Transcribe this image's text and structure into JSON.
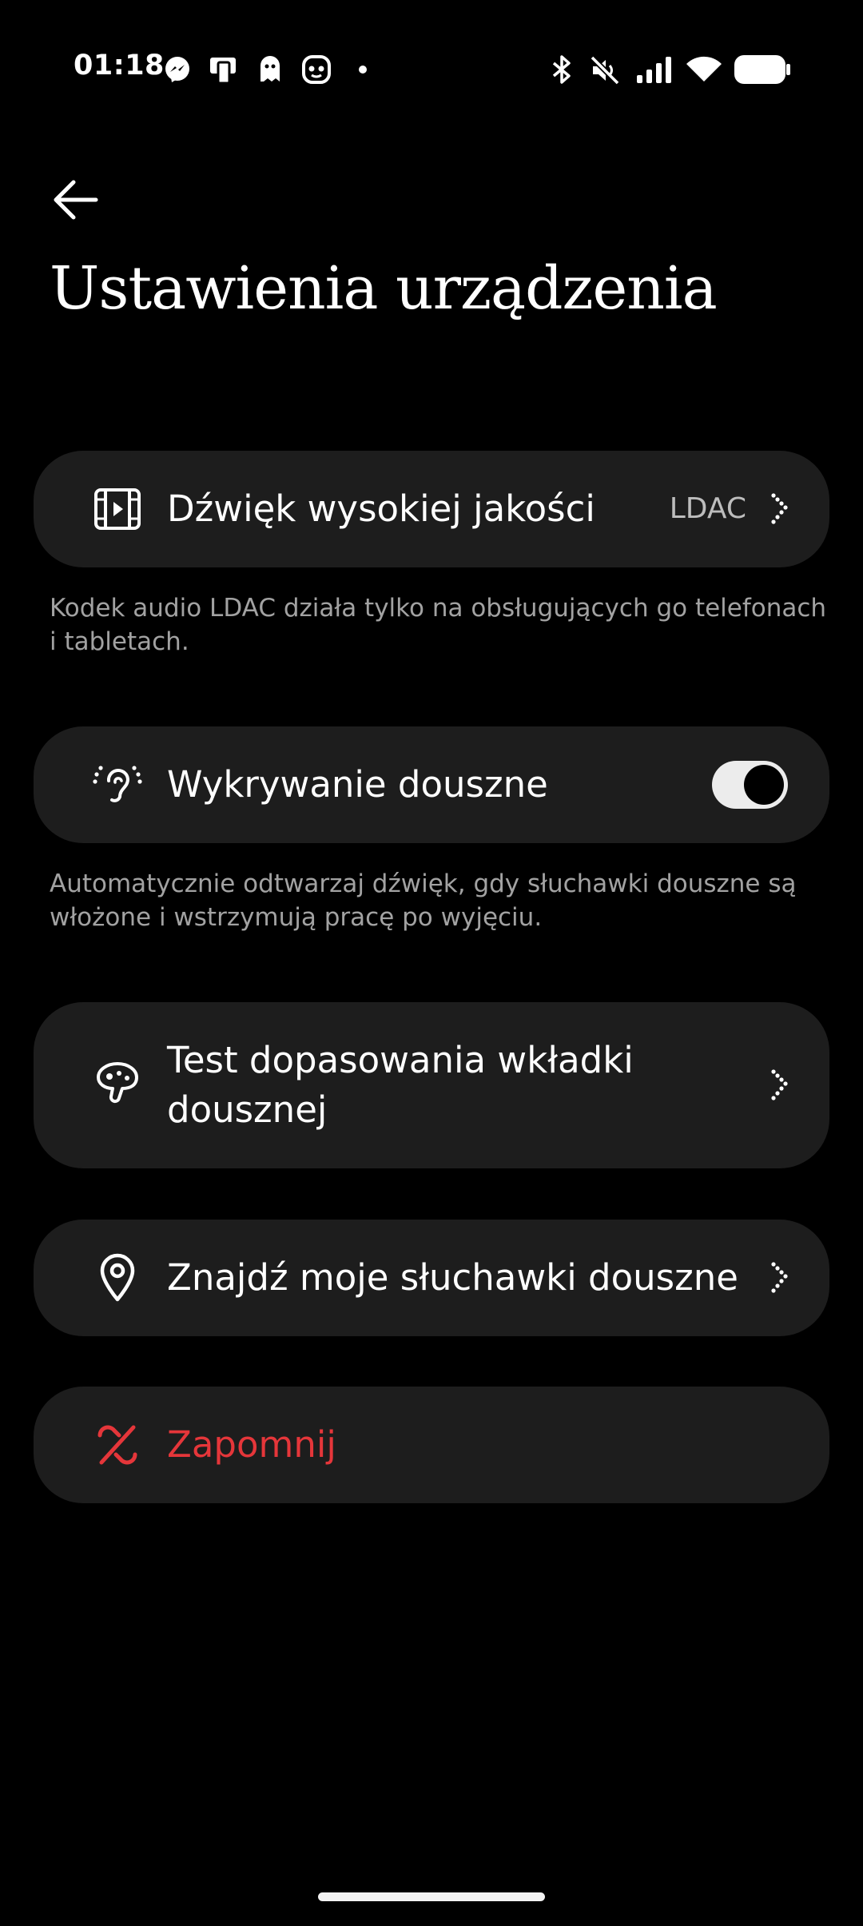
{
  "status_bar": {
    "time": "01:18",
    "left_icons": [
      "messenger-icon",
      "cast-phone-icon",
      "ghost-icon",
      "game-face-icon",
      "dot-icon"
    ],
    "right_icons": [
      "bluetooth-icon",
      "mute-icon",
      "signal-icon",
      "wifi-icon",
      "battery-icon"
    ]
  },
  "header": {
    "back_icon": "arrow-left-icon",
    "title": "Ustawienia urządzenia"
  },
  "settings": {
    "hq_audio": {
      "icon": "film-play-icon",
      "label": "Dźwięk wysokiej jakości",
      "value": "LDAC",
      "description": "Kodek audio LDAC działa tylko na obsługujących go telefonach i tabletach."
    },
    "in_ear": {
      "icon": "ear-sensor-icon",
      "label": "Wykrywanie douszne",
      "toggle_on": true,
      "description": "Automatycznie odtwarzaj dźwięk, gdy słuchawki douszne są włożone i wstrzymują pracę po wyjęciu."
    },
    "fit_test": {
      "icon": "earbud-tip-icon",
      "label_line1": "Test dopasowania wkładki",
      "label_line2": "dousznej"
    },
    "find": {
      "icon": "location-pin-icon",
      "label": "Znajdź moje słuchawki douszne"
    },
    "forget": {
      "icon": "unlink-icon",
      "label": "Zapomnij"
    }
  },
  "colors": {
    "background": "#000000",
    "card": "#1d1d1d",
    "danger": "#e5363a",
    "secondary_text": "#a2a2a2"
  }
}
